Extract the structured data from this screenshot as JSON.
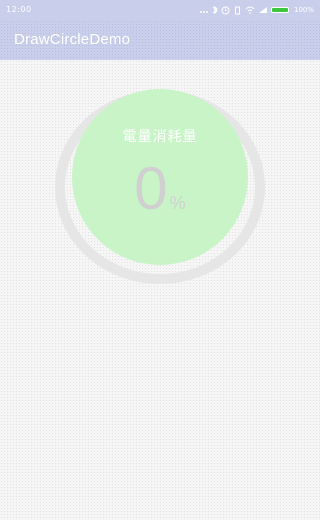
{
  "status_bar": {
    "time": "12:00",
    "battery_percent": "100%",
    "icons": [
      "signal-icon",
      "bluetooth-icon",
      "alarm-icon",
      "wifi-icon",
      "cell-signal-icon",
      "battery-icon"
    ]
  },
  "app_bar": {
    "title": "DrawCircleDemo",
    "color": "#c9ceea"
  },
  "gauge": {
    "label": "電量消耗量",
    "value": "0",
    "unit": "%",
    "progress": 0,
    "fill_color": "#c8f4c8",
    "track_color": "#e6e6e6"
  }
}
